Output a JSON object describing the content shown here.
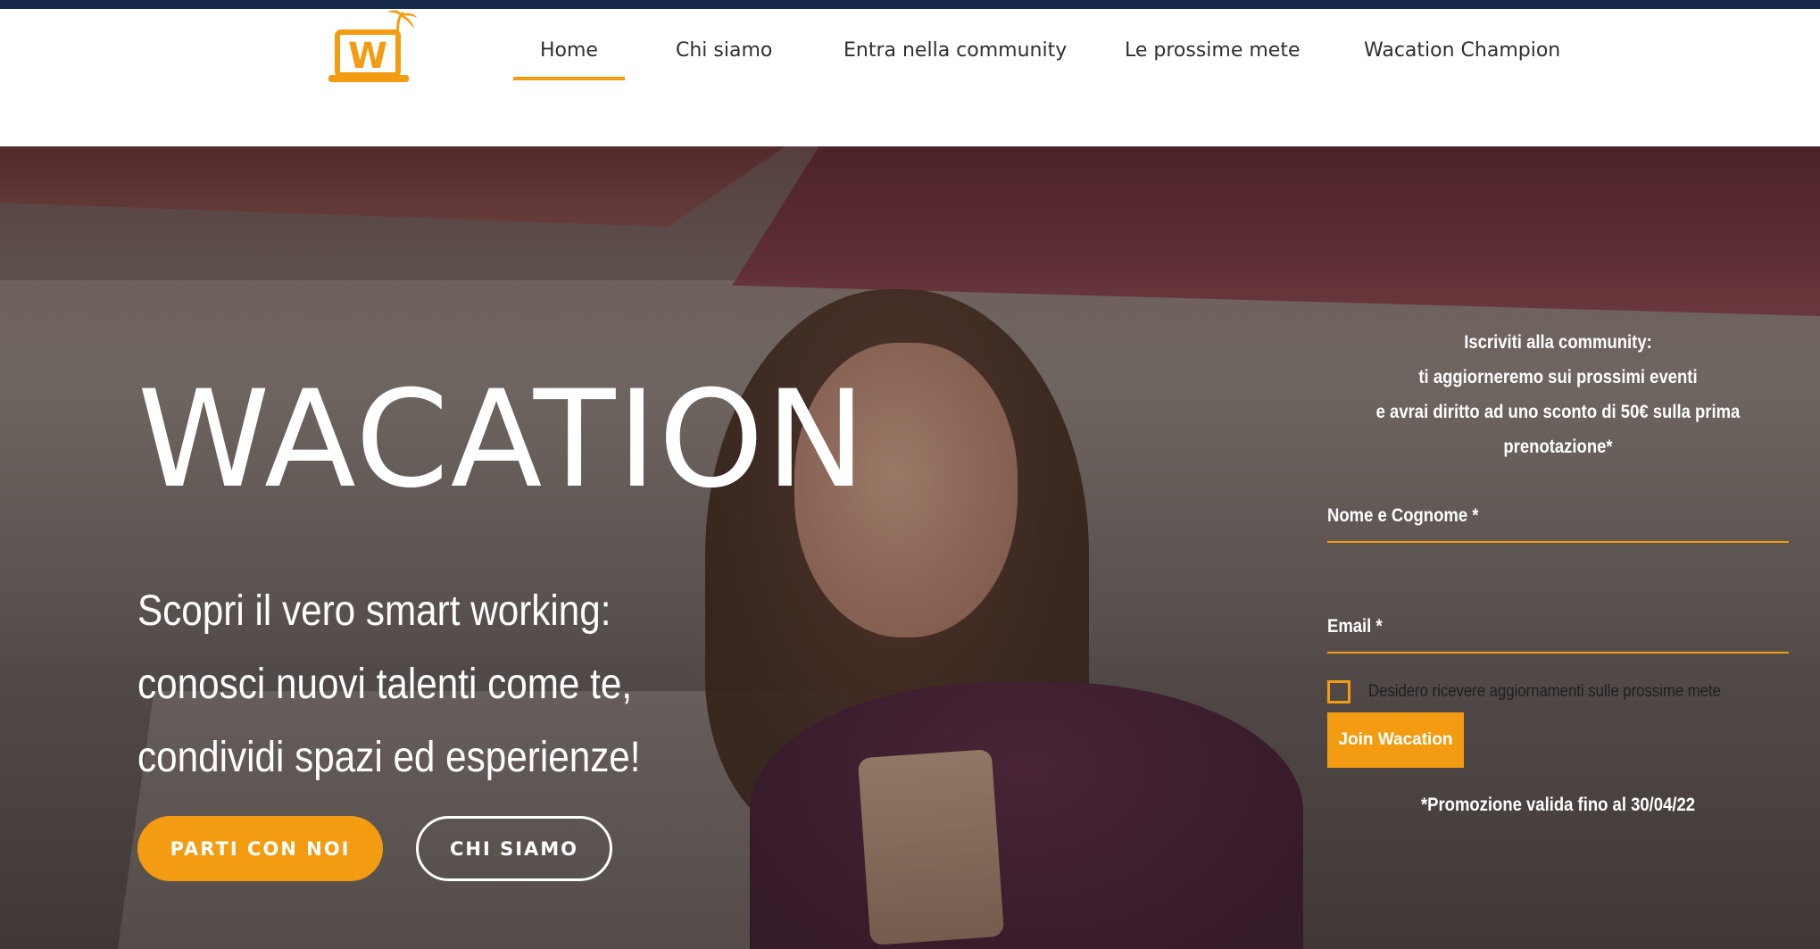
{
  "brand": {
    "logo_letter": "W"
  },
  "nav": {
    "items": [
      {
        "label": "Home",
        "active": true
      },
      {
        "label": "Chi siamo",
        "active": false
      },
      {
        "label": "Entra nella community",
        "active": false
      },
      {
        "label": "Le prossime mete",
        "active": false
      },
      {
        "label": "Wacation Champion",
        "active": false
      }
    ]
  },
  "hero": {
    "title": "WACATION",
    "subtitle_lines": [
      "Scopri il vero smart working:",
      "conosci nuovi talenti come te,",
      "condividi spazi ed esperienze!"
    ],
    "primary_button": "PARTI CON NOI",
    "secondary_button": "CHI SIAMO"
  },
  "form": {
    "intro_lines": [
      "Iscriviti alla community:",
      "ti aggiorneremo sui prossimi eventi",
      "e avrai diritto ad uno sconto di 50€ sulla prima",
      "prenotazione*"
    ],
    "name_label": "Nome e Cognome *",
    "email_label": "Email *",
    "checkbox_label": "Desidero ricevere aggiornamenti sulle prossime mete",
    "submit_label": "Join Wacation",
    "promo_note": "*Promozione valida fino al 30/04/22"
  },
  "colors": {
    "accent": "#f39c12",
    "topbar": "#14284b"
  }
}
